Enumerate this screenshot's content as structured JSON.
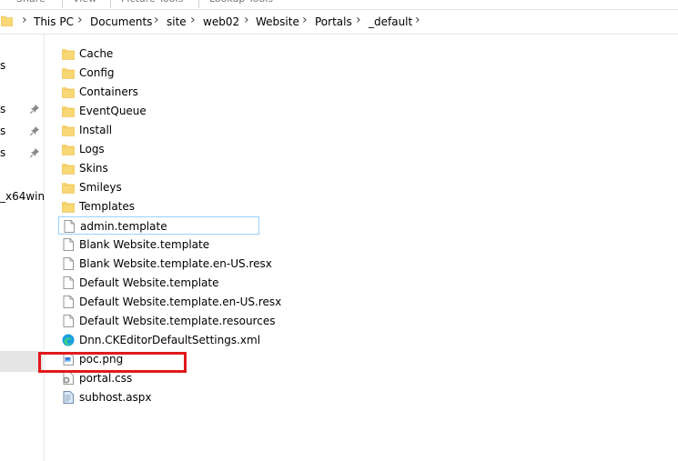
{
  "ribbon": {
    "tabs": [
      "Share",
      "View",
      "Picture Tools",
      "Lookup Tools"
    ]
  },
  "address": {
    "crumbs": [
      "This PC",
      "Documents",
      "site",
      "web02",
      "Website",
      "Portals",
      "_default"
    ]
  },
  "nav": {
    "items": [
      {
        "label": "s",
        "pinned": false
      },
      {
        "label": "s",
        "pinned": true
      },
      {
        "label": "s",
        "pinned": true
      },
      {
        "label": "s",
        "pinned": true
      },
      {
        "label": "_x64win",
        "pinned": false
      }
    ]
  },
  "files": [
    {
      "name": "Cache",
      "type": "folder"
    },
    {
      "name": "Config",
      "type": "folder"
    },
    {
      "name": "Containers",
      "type": "folder"
    },
    {
      "name": "EventQueue",
      "type": "folder"
    },
    {
      "name": "Install",
      "type": "folder"
    },
    {
      "name": "Logs",
      "type": "folder"
    },
    {
      "name": "Skins",
      "type": "folder"
    },
    {
      "name": "Smileys",
      "type": "folder"
    },
    {
      "name": "Templates",
      "type": "folder"
    },
    {
      "name": "admin.template",
      "type": "file",
      "focused": true
    },
    {
      "name": "Blank Website.template",
      "type": "file"
    },
    {
      "name": "Blank Website.template.en-US.resx",
      "type": "file"
    },
    {
      "name": "Default Website.template",
      "type": "file"
    },
    {
      "name": "Default Website.template.en-US.resx",
      "type": "file"
    },
    {
      "name": "Default Website.template.resources",
      "type": "file"
    },
    {
      "name": "Dnn.CKEditorDefaultSettings.xml",
      "type": "edge-xml"
    },
    {
      "name": "poc.png",
      "type": "image",
      "highlighted": true
    },
    {
      "name": "portal.css",
      "type": "css"
    },
    {
      "name": "subhost.aspx",
      "type": "aspx"
    }
  ],
  "colors": {
    "folder": "#f8d775",
    "folder_dark": "#e8b84a",
    "highlight_box": "#e0191b",
    "focus_border": "#99d1ff",
    "selection": "#e5e5e5"
  }
}
